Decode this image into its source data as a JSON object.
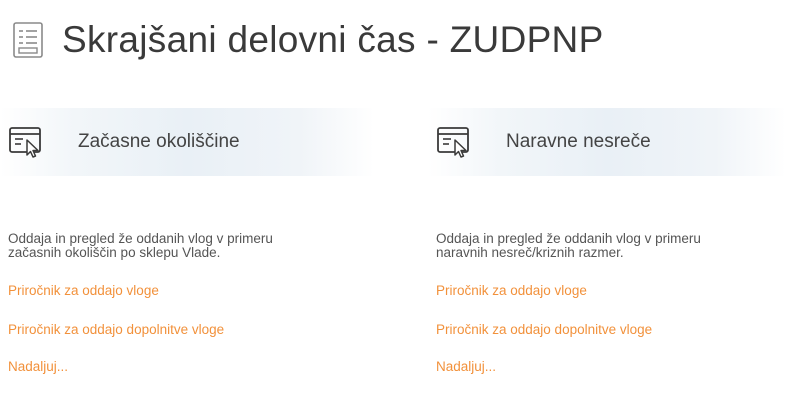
{
  "header": {
    "title": "Skrajšani delovni čas - ZUDPNP",
    "icon": "list-document-icon"
  },
  "colors": {
    "link": "#f2913b",
    "title": "#3a3a3a",
    "card_head_bg": "#e9f0f6"
  },
  "cards": [
    {
      "icon": "form-cursor-icon",
      "title": "Začasne okoliščine",
      "description_lines": [
        "Oddaja in pregled že oddanih vlog v primeru",
        "začasnih okoliščin po sklepu Vlade."
      ],
      "links": [
        "Priročnik za oddajo vloge",
        "Priročnik za oddajo dopolnitve vloge",
        "Nadaljuj..."
      ]
    },
    {
      "icon": "form-cursor-icon",
      "title": "Naravne nesreče",
      "description_lines": [
        "Oddaja in pregled že oddanih vlog v primeru",
        "naravnih nesreč/kriznih razmer."
      ],
      "links": [
        "Priročnik za oddajo vloge",
        "Priročnik za oddajo dopolnitve vloge",
        "Nadaljuj..."
      ]
    }
  ]
}
